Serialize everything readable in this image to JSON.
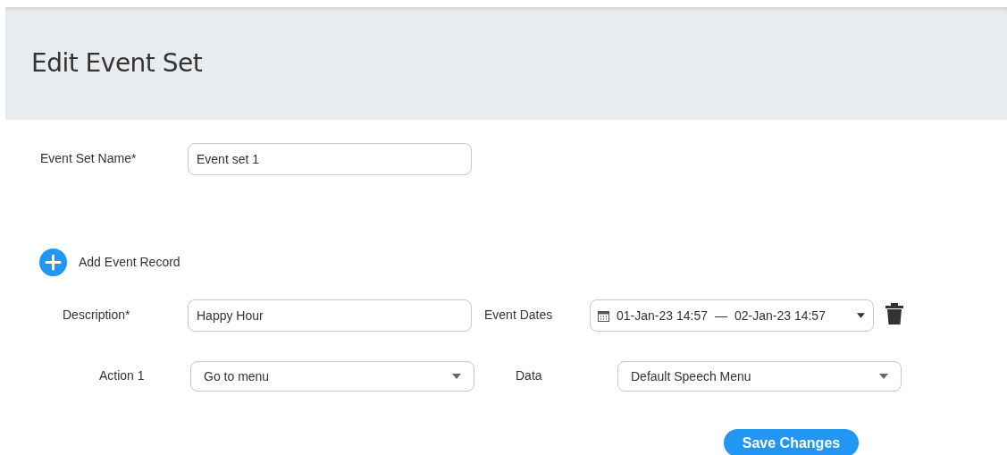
{
  "header": {
    "title": "Edit Event Set"
  },
  "event_set_name": {
    "label": "Event Set Name*",
    "value": "Event set 1"
  },
  "add_record": {
    "label": "Add Event Record"
  },
  "record": {
    "description": {
      "label": "Description*",
      "value": "Happy Hour"
    },
    "event_dates": {
      "label": "Event Dates",
      "start": "01-Jan-23 14:57",
      "separator": "—",
      "end": "02-Jan-23 14:57"
    },
    "action": {
      "label": "Action 1",
      "value": "Go to menu"
    },
    "data": {
      "label": "Data",
      "value": "Default Speech Menu"
    }
  },
  "save_button": {
    "label": "Save Changes"
  }
}
